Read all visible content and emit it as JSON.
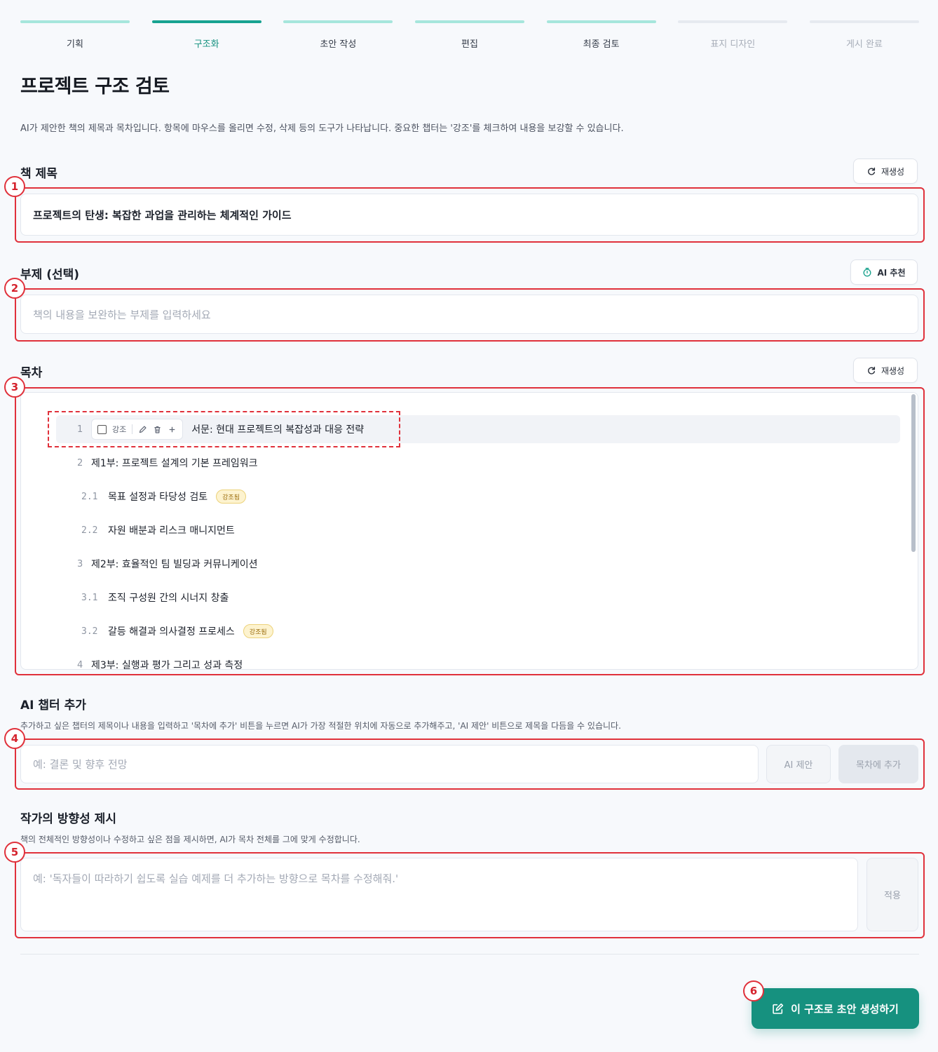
{
  "stepper": {
    "steps": [
      {
        "label": "기획",
        "state": "done"
      },
      {
        "label": "구조화",
        "state": "active"
      },
      {
        "label": "초안 작성",
        "state": "done"
      },
      {
        "label": "편집",
        "state": "done"
      },
      {
        "label": "최종 검토",
        "state": "done"
      },
      {
        "label": "표지 디자인",
        "state": "todo"
      },
      {
        "label": "게시 완료",
        "state": "todo"
      }
    ]
  },
  "page": {
    "title": "프로젝트 구조 검토",
    "description": "AI가 제안한 책의 제목과 목차입니다. 항목에 마우스를 올리면 수정, 삭제 등의 도구가 나타납니다. 중요한 챕터는 '강조'를 체크하여 내용을 보강할 수 있습니다."
  },
  "book_title": {
    "label": "책 제목",
    "regenerate_label": "재생성",
    "value": "프로젝트의 탄생: 복잡한 과업을 관리하는 체계적인 가이드"
  },
  "subtitle": {
    "label": "부제 (선택)",
    "ai_button_label": "AI 추천",
    "placeholder": "책의 내용을 보완하는 부제를 입력하세요"
  },
  "toc": {
    "label": "목차",
    "regenerate_label": "재생성",
    "toolbar": {
      "emphasis_label": "강조"
    },
    "emphasized_tag": "강조됨",
    "items": [
      {
        "num": "1",
        "title": "서문: 현대 프로젝트의 복잡성과 대응 전략",
        "level": 1,
        "emphasized": false,
        "hovered": true
      },
      {
        "num": "2",
        "title": "제1부: 프로젝트 설계의 기본 프레임워크",
        "level": 1,
        "emphasized": false
      },
      {
        "num": "2.1",
        "title": "목표 설정과 타당성 검토",
        "level": 2,
        "emphasized": true
      },
      {
        "num": "2.2",
        "title": "자원 배분과 리스크 매니지먼트",
        "level": 2,
        "emphasized": false
      },
      {
        "num": "3",
        "title": "제2부: 효율적인 팀 빌딩과 커뮤니케이션",
        "level": 1,
        "emphasized": false
      },
      {
        "num": "3.1",
        "title": "조직 구성원 간의 시너지 창출",
        "level": 2,
        "emphasized": false
      },
      {
        "num": "3.2",
        "title": "갈등 해결과 의사결정 프로세스",
        "level": 2,
        "emphasized": true
      },
      {
        "num": "4",
        "title": "제3부: 실행과 평가 그리고 성과 측정",
        "level": 1,
        "emphasized": false
      }
    ]
  },
  "ai_chapter": {
    "label": "AI 챕터 추가",
    "description": "추가하고 싶은 챕터의 제목이나 내용을 입력하고 '목차에 추가' 비튼을 누르면 AI가 가장 적절한 위치에 자동으로 추가해주고, 'AI 제안' 비튼으로 제목을 다듬을 수 있습니다.",
    "placeholder": "예: 결론 및 향후 전망",
    "suggest_label": "AI 제안",
    "add_label": "목차에 추가"
  },
  "direction": {
    "label": "작가의 방향성 제시",
    "description": "책의 전체적인 방향성이나 수정하고 싶은 점을 제시하면, AI가 목차 전체를 그에 맞게 수정합니다.",
    "placeholder": "예: '독자들이 따라하기 쉽도록 실습 예제를 더 추가하는 방향으로 목차를 수정해줘.'",
    "apply_label": "적용"
  },
  "primary_action": {
    "label": "이 구조로 초안 생성하기"
  },
  "annotations": [
    "1",
    "2",
    "3",
    "4",
    "5",
    "6"
  ],
  "colors": {
    "accent": "#16917f",
    "annotation": "#e0313b",
    "emphasis_tag_bg": "#fdf3cf"
  }
}
